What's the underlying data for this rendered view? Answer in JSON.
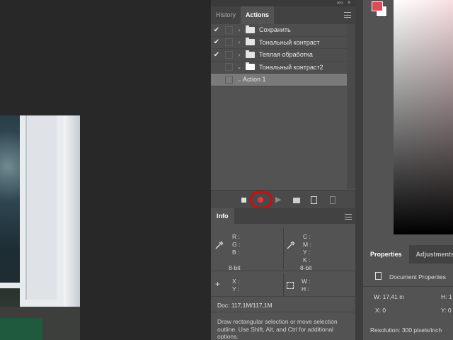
{
  "actions_panel": {
    "tabs": [
      "History",
      "Actions"
    ],
    "collapse_label": "««",
    "close_label": "×",
    "items": [
      {
        "checked": "✔",
        "label": "Сохранить"
      },
      {
        "checked": "✔",
        "label": "Тональный контраст"
      },
      {
        "checked": "✔",
        "label": "Теплая обработка"
      },
      {
        "checked": "",
        "label": "Тональный контраст2"
      }
    ],
    "sub_item": "Action 1",
    "toolbar_icons": [
      "stop-icon",
      "record-icon",
      "play-icon",
      "new-set-icon",
      "new-action-icon",
      "delete-icon"
    ],
    "play_glyph": "▶"
  },
  "info_panel": {
    "tab": "Info",
    "rgb_labels": [
      "R :",
      "G :",
      "B :"
    ],
    "cmyk_labels": [
      "C :",
      "M :",
      "Y :",
      "K :"
    ],
    "bit_left": "8-bit",
    "bit_right": "8-bit",
    "xy_labels": [
      "X :",
      "Y :"
    ],
    "wh_labels": [
      "W :",
      "H :"
    ],
    "doc": "Doc: 117,1M/117,1M",
    "hint": "Draw rectangular selection or move selection outline.  Use Shift, Alt, and Ctrl for additional options."
  },
  "color_panel": {
    "foreground": "#e04a57",
    "background": "#ffffff"
  },
  "properties_panel": {
    "tabs": [
      "Properties",
      "Adjustments"
    ],
    "title": "Document Properties",
    "w": "W:  17,41 in",
    "h": "H:  1",
    "x": "X:  0",
    "y": "Y:  0",
    "resolution": "Resolution: 300 pixels/inch"
  }
}
